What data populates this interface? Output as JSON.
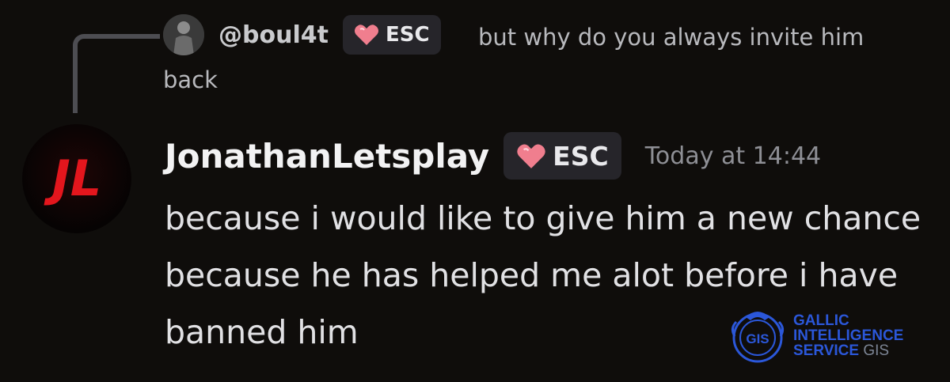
{
  "reply": {
    "username": "@boul4t",
    "tag": "ESC",
    "text": "but why do you always invite him back"
  },
  "message": {
    "username": "JonathanLetsplay",
    "tag": "ESC",
    "timestamp": "Today at 14:44",
    "text": "because i would like to give him a new chance because he has helped me alot before i have banned him"
  },
  "avatar": {
    "monogram": "JL",
    "color": "#e3161d"
  },
  "watermark": {
    "line1": "GALLIC",
    "line2": "INTELLIGENCE",
    "line3": "SERVICE",
    "suffix": "GIS",
    "seal_text": "GIS",
    "color": "#2b57d9"
  },
  "colors": {
    "background": "#0f0d0b",
    "tag_background": "#26252a",
    "heart": "#f07e8e"
  }
}
